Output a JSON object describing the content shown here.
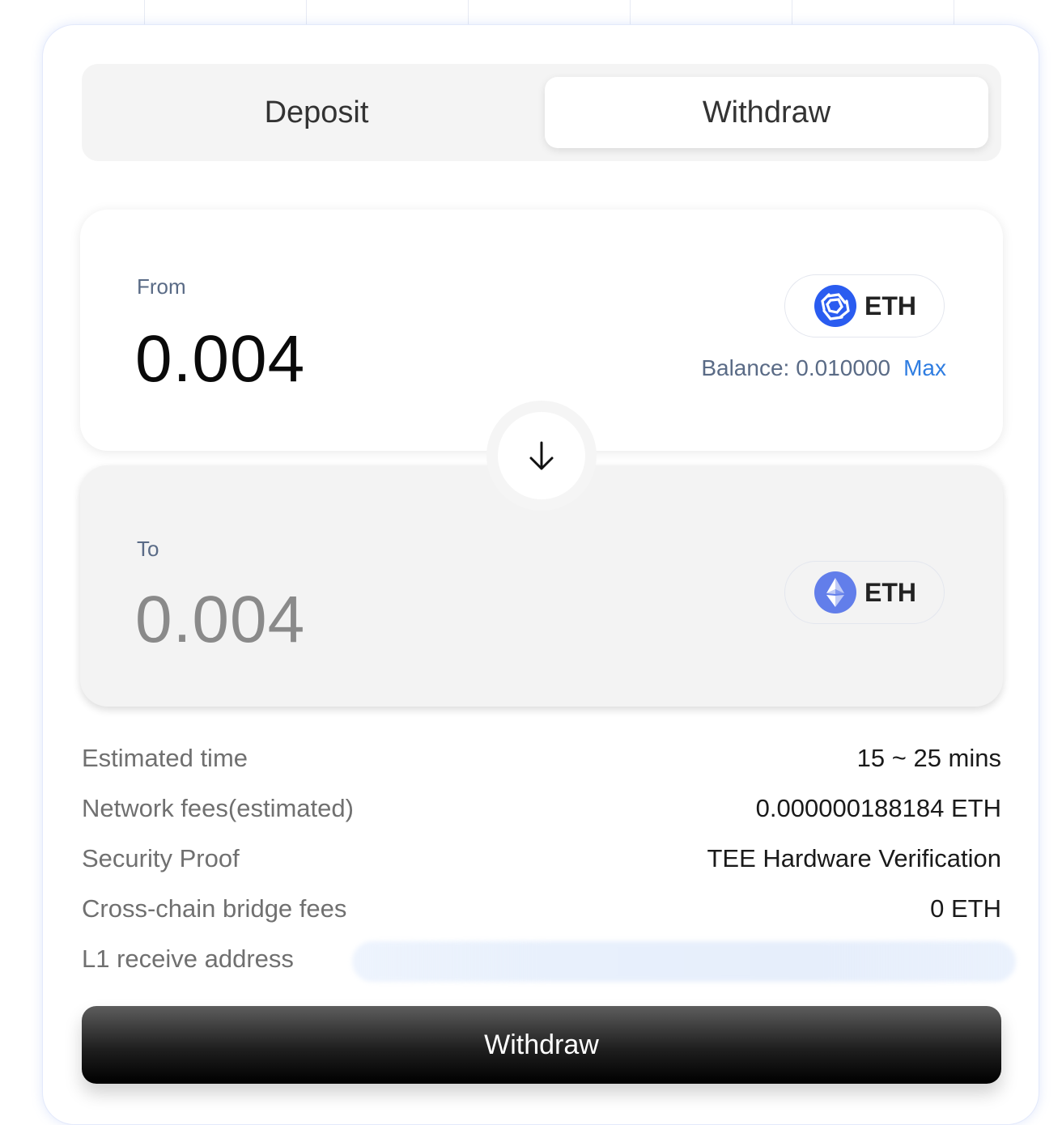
{
  "tabs": {
    "deposit_label": "Deposit",
    "withdraw_label": "Withdraw",
    "active": "Withdraw"
  },
  "from": {
    "label": "From",
    "amount": "0.004",
    "token": "ETH",
    "token_icon": "chain-logo-icon",
    "balance_label": "Balance:",
    "balance_value": "0.010000",
    "max_label": "Max"
  },
  "swap": {
    "icon": "arrow-down-icon"
  },
  "to": {
    "label": "To",
    "amount": "0.004",
    "token": "ETH",
    "token_icon": "ethereum-icon"
  },
  "details": [
    {
      "label": "Estimated time",
      "value": "15 ~ 25 mins"
    },
    {
      "label": "Network fees(estimated)",
      "value": "0.000000188184 ETH"
    },
    {
      "label": "Security Proof",
      "value": "TEE Hardware Verification"
    },
    {
      "label": "Cross-chain bridge fees",
      "value": "0 ETH"
    },
    {
      "label": "L1 receive address",
      "value": ""
    }
  ],
  "submit_label": "Withdraw",
  "colors": {
    "accent_blue": "#2f7de1",
    "label_gray": "#5a6b86",
    "button_dark": "#000000",
    "token_blue": "#2a5cf0",
    "eth_blue": "#627eea"
  }
}
